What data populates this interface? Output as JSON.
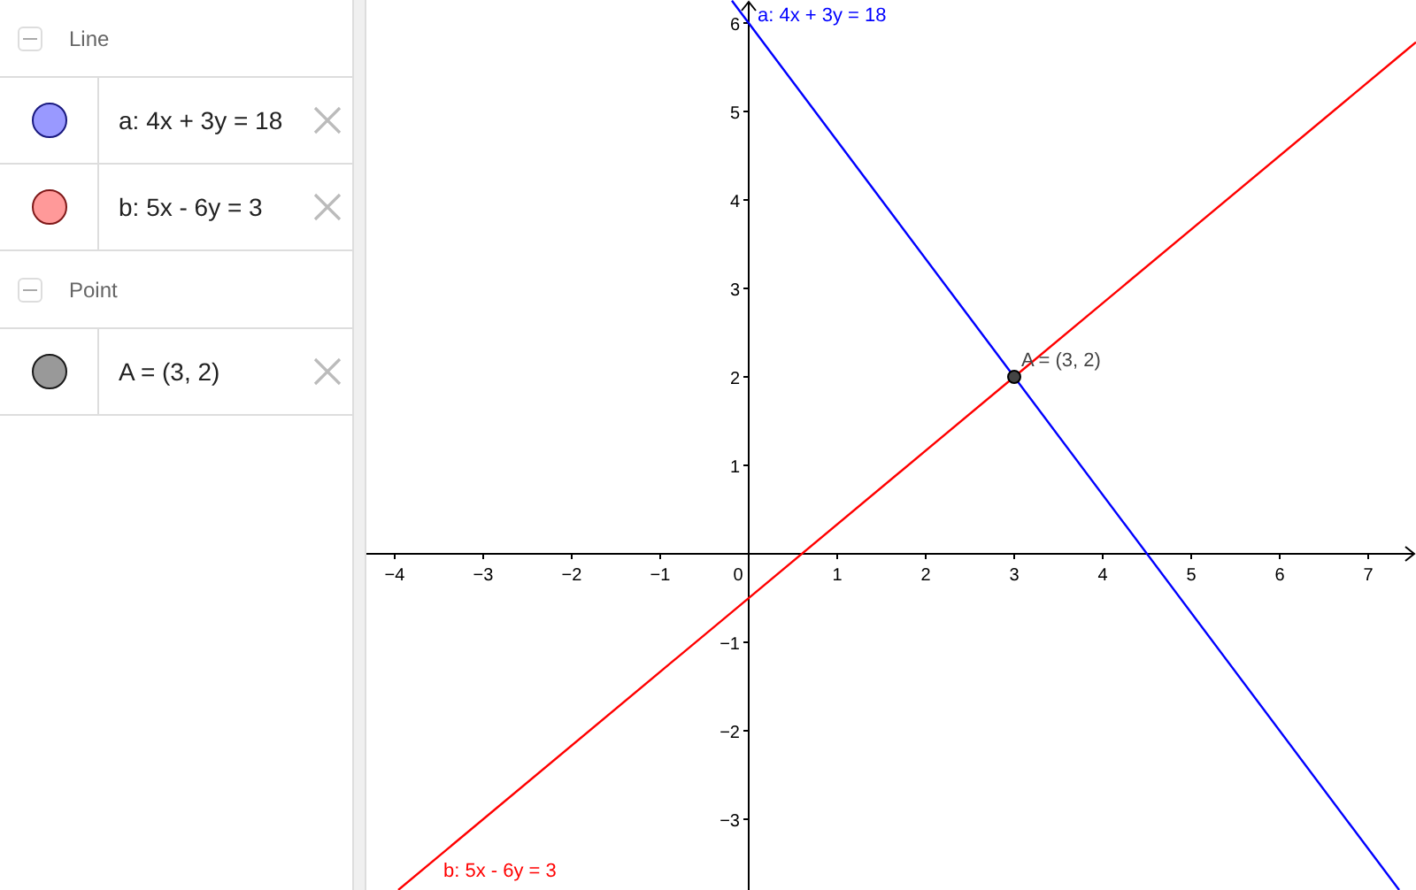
{
  "algebra": {
    "groups": [
      {
        "label": "Line",
        "expanded": true,
        "items": [
          {
            "text": "a: 4x + 3y = 18",
            "color": "#9999ff"
          },
          {
            "text": "b: 5x - 6y = 3",
            "color": "#ff9999"
          }
        ]
      },
      {
        "label": "Point",
        "expanded": true,
        "items": [
          {
            "text": "A = (3, 2)",
            "color": "#999999"
          }
        ]
      }
    ]
  },
  "graphics": {
    "chart_data": {
      "type": "line",
      "x": [
        -3.96,
        -0.19,
        3,
        7.35,
        7.54
      ],
      "series": [
        {
          "color": "#0000ff",
          "values": [
            null,
            6.253,
            2,
            -3.8,
            null
          ]
        },
        {
          "color": "#ff0000",
          "values": [
            -3.8,
            -0.658,
            2,
            5.625,
            5.783
          ]
        }
      ],
      "xlim": [
        -4.32,
        7.54
      ],
      "ylim": [
        -3.8,
        6.26
      ],
      "xticks": [
        {
          "value": -4,
          "label": "−4"
        },
        {
          "value": -3,
          "label": "−3"
        },
        {
          "value": -2,
          "label": "−2"
        },
        {
          "value": -1,
          "label": "−1"
        },
        {
          "value": 0,
          "label": "0"
        },
        1,
        2,
        3,
        4,
        5,
        6,
        7
      ],
      "yticks": [
        {
          "value": -3,
          "label": "−3"
        },
        {
          "value": -2,
          "label": "−2"
        },
        {
          "value": -1,
          "label": "−1"
        },
        1,
        2,
        3,
        4,
        5,
        6
      ],
      "annotations": [
        "a: 4x + 3y = 18",
        "b: 5x - 6y = 3",
        {
          "text": "A = (3, 2)",
          "x": 3,
          "y": 2
        }
      ]
    }
  }
}
